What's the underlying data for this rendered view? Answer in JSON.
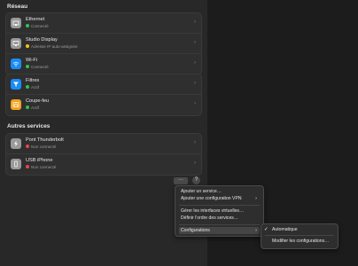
{
  "section_reseau": "Réseau",
  "services": [
    {
      "name": "Ethernet",
      "status": "Connecté",
      "status_color": "#32c153",
      "icon": "ethernet-icon",
      "icon_color": "#9a9a9a"
    },
    {
      "name": "Studio Display",
      "status": "Adresse IP auto-assignée",
      "status_color": "#f5c518",
      "icon": "display-icon",
      "icon_color": "#9a9a9a"
    },
    {
      "name": "Wi-Fi",
      "status": "Connecté",
      "status_color": "#32c153",
      "icon": "wifi-icon",
      "icon_color": "#1a8cf5"
    }
  ],
  "security": [
    {
      "name": "Filtres",
      "status": "Actif",
      "status_color": "#32c153",
      "icon": "filter-icon",
      "icon_color": "#1a8cf5"
    },
    {
      "name": "Coupe-feu",
      "status": "Actif",
      "status_color": "#32c153",
      "icon": "firewall-icon",
      "icon_color": "#f2a21b"
    }
  ],
  "section_autres": "Autres services",
  "other_services": [
    {
      "name": "Pont Thunderbolt",
      "status": "Non connecté",
      "status_color": "#e5484d",
      "icon": "thunderbolt-icon",
      "icon_color": "#9a9a9a"
    },
    {
      "name": "USB iPhone",
      "status": "Non connecté",
      "status_color": "#e5484d",
      "icon": "iphone-icon",
      "icon_color": "#9a9a9a"
    }
  ],
  "more_button": "···",
  "help_button": "?",
  "menu": {
    "add_service": "Ajouter un service…",
    "add_vpn": "Ajouter une configuration VPN",
    "manage_virtual": "Gérer les interfaces virtuelles…",
    "set_order": "Définir l'ordre des services…",
    "configurations": "Configurations"
  },
  "submenu": {
    "automatic": "Automatique",
    "modify": "Modifier les configurations…"
  }
}
